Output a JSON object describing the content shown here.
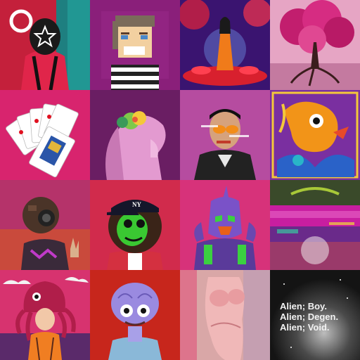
{
  "gallery": {
    "tiles": [
      {
        "name": "masked-guard-art",
        "bg": "#c4203b"
      },
      {
        "name": "pixel-boy-art",
        "bg": "#8a1f7a"
      },
      {
        "name": "woman-red-flowers-art",
        "bg": "#3a1470"
      },
      {
        "name": "pink-tree-art",
        "bg": "#e6a5c4"
      },
      {
        "name": "playing-cards-art",
        "bg": "#d8246e"
      },
      {
        "name": "woman-flower-head-art",
        "bg": "#6a1e63"
      },
      {
        "name": "glitch-man-portrait-art",
        "bg": "#b64ca0"
      },
      {
        "name": "colorful-creature-art",
        "bg": "#7a2fa0"
      },
      {
        "name": "gasmask-robot-art",
        "bg": "#b5336a"
      },
      {
        "name": "green-lion-cap-art",
        "bg": "#d12b4c"
      },
      {
        "name": "purple-mecha-art",
        "bg": "#d7327a"
      },
      {
        "name": "glitch-landscape-art",
        "bg": "#2b1a3d"
      },
      {
        "name": "octopus-kid-art",
        "bg": "#d7336f"
      },
      {
        "name": "purple-alien-art",
        "bg": "#c7261c"
      },
      {
        "name": "pink-torso-art",
        "bg": "#d9a7a7"
      },
      {
        "name": "alien-text-art",
        "bg": "#161616"
      }
    ],
    "alien_text": [
      "Alien; Boy.",
      "Alien; Degen.",
      "Alien; Void."
    ]
  }
}
